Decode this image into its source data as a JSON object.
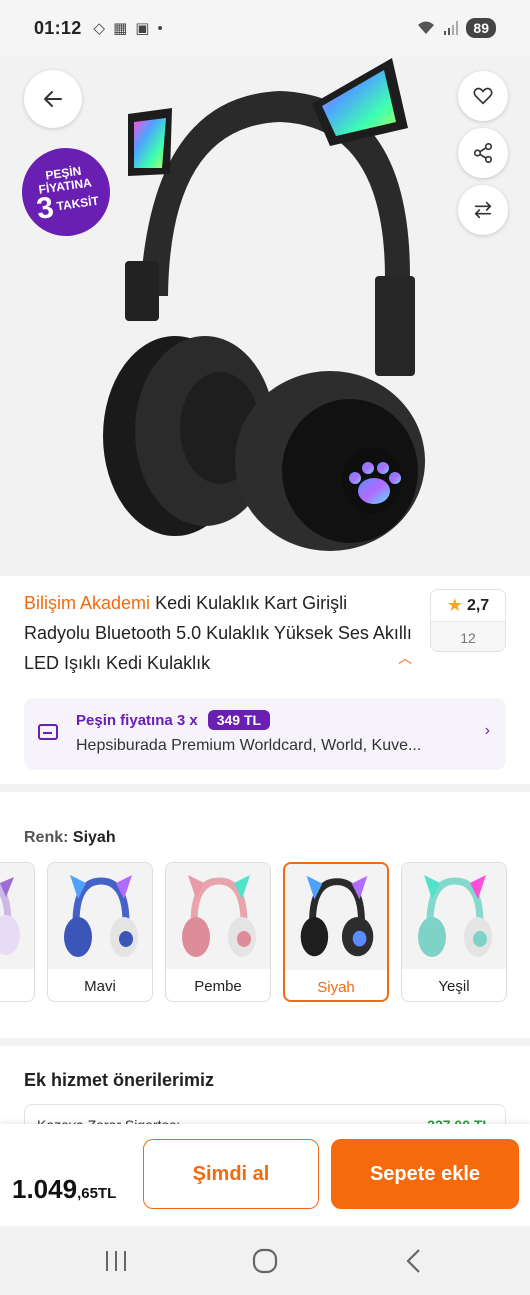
{
  "status_bar": {
    "time": "01:12",
    "battery": "89"
  },
  "hero": {
    "badge": {
      "line1": "PEŞİN",
      "line2": "FİYATINA",
      "number": "3",
      "word": "TAKSİT"
    }
  },
  "product": {
    "brand": "Bilişim Akademi",
    "title": "Kedi Kulaklık Kart Girişli Radyolu Bluetooth 5.0 Kulaklık Yüksek Ses Akıllı LED Işıklı Kedi Kulaklık",
    "rating": "2,7",
    "review_count": "12"
  },
  "installment": {
    "label": "Peşin fiyatına 3 x",
    "price": "349 TL",
    "cards": "Hepsiburada Premium Worldcard, World, Kuve..."
  },
  "colors": {
    "label": "Renk:",
    "selected": "Siyah",
    "options": [
      {
        "label": "",
        "ear": "#9b6fd6",
        "band": "#d9c9ec",
        "cup": "#cdb8e8"
      },
      {
        "label": "Mavi",
        "ear": "#4a6fd0",
        "band": "#4562c9",
        "cup": "#3b55b8"
      },
      {
        "label": "Pembe",
        "ear": "#e79aa8",
        "band": "#e8a5ae",
        "cup": "#de8c99"
      },
      {
        "label": "Siyah",
        "ear": "#222222",
        "band": "#2a2a2a",
        "cup": "#1e1e1e"
      },
      {
        "label": "Yeşil",
        "ear": "#6fcfc4",
        "band": "#84d8cc",
        "cup": "#7fd3c6"
      }
    ]
  },
  "services": {
    "title": "Ek hizmet önerilerimiz",
    "item_name": "Kazaya Zarar Sigortası",
    "item_price": "227,00 TL"
  },
  "bottom": {
    "price_main": "1.049",
    "price_frac": ",65TL",
    "buy_now": "Şimdi al",
    "add_to_cart": "Sepete ekle"
  },
  "colors_theme": {
    "accent": "#f26a10",
    "purple": "#6a1fb3"
  }
}
